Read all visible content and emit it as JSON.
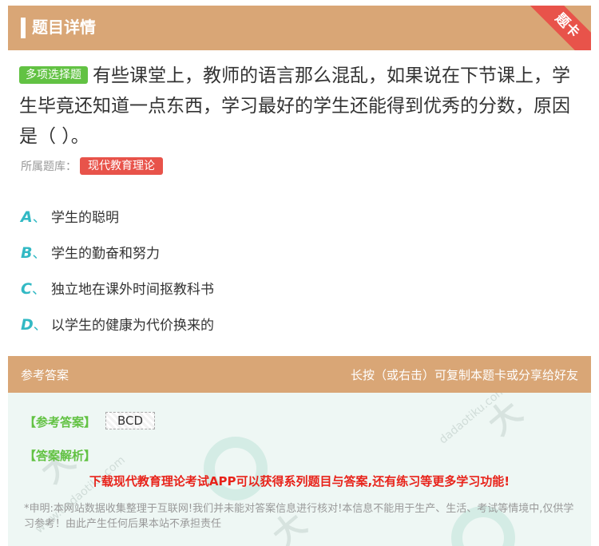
{
  "header": {
    "title": "题目详情",
    "ribbon": "题卡"
  },
  "question": {
    "type_tag": "多项选择题",
    "text": "有些课堂上，教师的语言那么混乱，如果说在下节课上，学生毕竟还知道一点东西，学习最好的学生还能得到优秀的分数，原因是（ ）。"
  },
  "bank": {
    "label": "所属题库：",
    "name": "现代教育理论"
  },
  "options": [
    {
      "letter": "A",
      "sep": "、",
      "text": "学生的聪明"
    },
    {
      "letter": "B",
      "sep": "、",
      "text": "学生的勤奋和努力"
    },
    {
      "letter": "C",
      "sep": "、",
      "text": "独立地在课外时间抠教科书"
    },
    {
      "letter": "D",
      "sep": "、",
      "text": "以学生的健康为代价换来的"
    }
  ],
  "answer_section": {
    "title": "参考答案",
    "hint": "长按（或右击）可复制本题卡或分享给好友",
    "ref_label": "【参考答案】",
    "ref_value": "BCD",
    "analysis_label": "【答案解析】",
    "promo": "下载现代教育理论考试APP可以获得系列题目与答案,还有练习等更多学习功能!",
    "disclaimer": "*申明:本网站数据收集整理于互联网!我们并未能对答案信息进行核对!本信息不能用于生产、生活、考试等情境中,仅供学习参考！由此产生任何后果本站不承担责任"
  },
  "colors": {
    "header_bg": "#d9a676",
    "ribbon": "#e8534a",
    "tag_green": "#62c243",
    "tag_red": "#e8534a",
    "option_letter": "#32b9c4",
    "promo_red": "#e8231a"
  }
}
